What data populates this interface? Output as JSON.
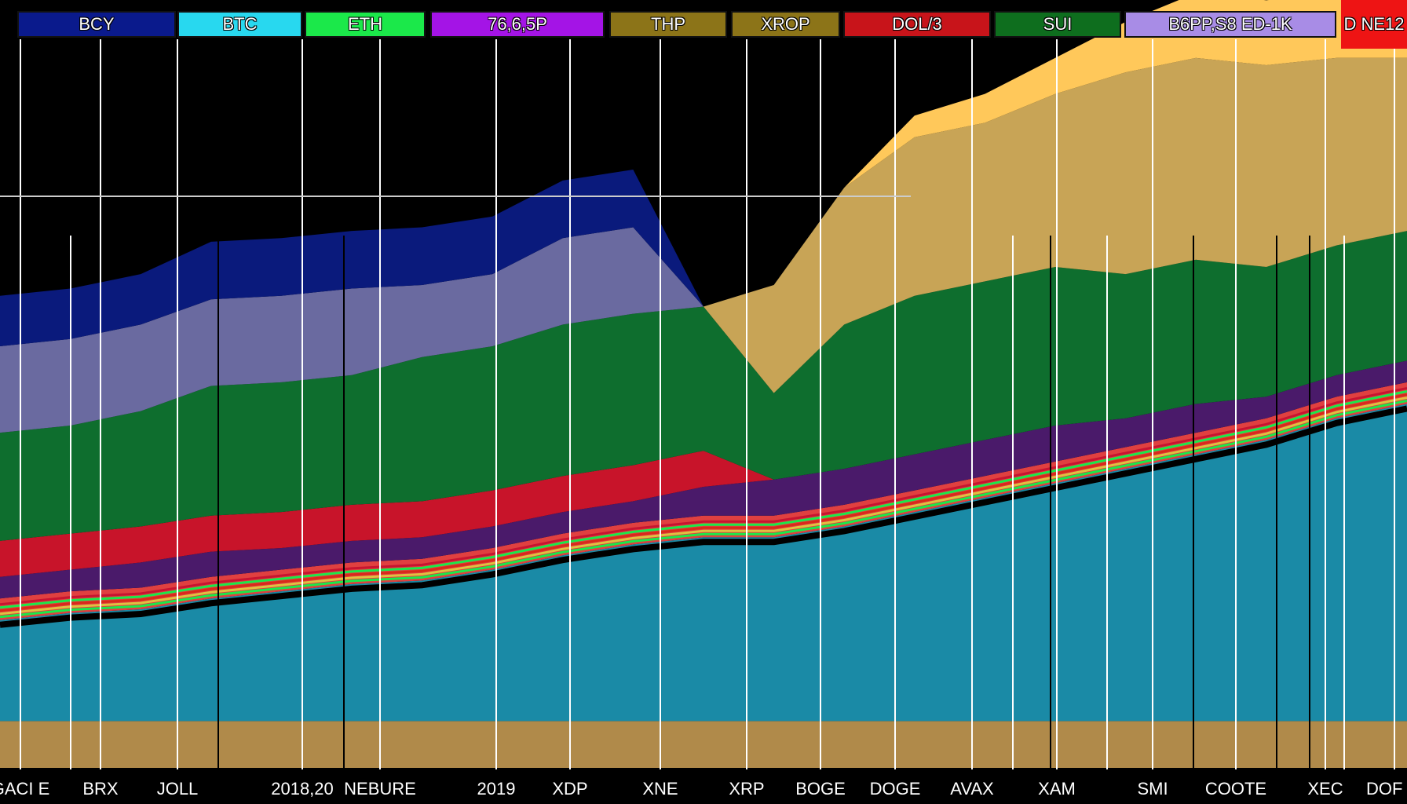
{
  "chart_data": {
    "type": "area",
    "title": "",
    "xlabel": "",
    "ylabel": "",
    "legend": {
      "placement": "top",
      "entries": [
        {
          "label": "BCY",
          "color": "#0a1a8c"
        },
        {
          "label": "BTC",
          "color": "#28d8ef"
        },
        {
          "label": "ETH",
          "color": "#1be84a"
        },
        {
          "label": "76,6,5P",
          "color": "#a414e6"
        },
        {
          "label": "THP",
          "color": "#8c7418"
        },
        {
          "label": "XROP",
          "color": "#8c7418"
        },
        {
          "label": "DOL/3",
          "color": "#c8141a"
        },
        {
          "label": "SUI",
          "color": "#0e6e1e"
        },
        {
          "label": "B6PP,S8 ED-1K",
          "color": "#a88ce6"
        },
        {
          "label": "D NE12",
          "color": "#ee1414"
        }
      ]
    },
    "x_tick_labels": [
      "GACI E",
      "BRX",
      "JOLL",
      "2018,20",
      "NEBURE",
      "2019",
      "XDP",
      "XNE",
      "XRP",
      "BOGE",
      "DOGE",
      "AVAX",
      "XAM",
      "SMI",
      "COOTE",
      "XEC",
      "DOF"
    ],
    "grid": true,
    "ylim": [
      0,
      100
    ],
    "x": [
      0,
      1,
      2,
      3,
      4,
      5,
      6,
      7,
      8,
      9,
      10,
      11,
      12,
      13,
      14,
      15,
      16,
      17,
      18,
      19,
      20
    ],
    "series": [
      {
        "color": "#b08a4a",
        "values": [
          6.5,
          6.5,
          6.5,
          6.5,
          6.5,
          6.5,
          6.5,
          6.5,
          6.5,
          6.5,
          6.5,
          6.5,
          6.5,
          6.5,
          6.5,
          6.5,
          6.5,
          6.5,
          6.5,
          6.5,
          6.5
        ]
      },
      {
        "color": "#1a8aa6",
        "values": [
          14,
          15,
          15.5,
          17,
          18,
          19,
          19.5,
          21,
          23,
          24.5,
          25.5,
          25.5,
          27,
          29,
          31,
          33,
          35,
          37,
          39,
          42,
          44
        ]
      },
      {
        "color": "#e04040",
        "values": [
          3,
          3,
          3,
          3,
          3,
          3,
          3,
          3,
          3,
          3,
          3,
          3,
          3,
          3,
          3,
          3,
          3,
          3,
          3,
          3,
          3
        ]
      },
      {
        "color": "#4a1a6a",
        "values": [
          3,
          3,
          3.5,
          3.5,
          3,
          3,
          3,
          3,
          3,
          3,
          4,
          5,
          5,
          5,
          5,
          5,
          4,
          4,
          3,
          3,
          3
        ]
      },
      {
        "color": "#c8142a",
        "values": [
          5,
          5,
          5,
          5,
          5,
          5,
          5,
          5,
          5,
          5,
          5,
          0,
          0,
          0,
          0,
          0,
          0,
          0,
          0,
          0,
          0
        ]
      },
      {
        "color": "#0e6e2e",
        "values": [
          15,
          15,
          16,
          18,
          18,
          18,
          20,
          20,
          21,
          21,
          20,
          12,
          20,
          22,
          22,
          22,
          20,
          20,
          18,
          18,
          18
        ]
      },
      {
        "color": "#6a6aa0",
        "values": [
          12,
          12,
          12,
          12,
          12,
          12,
          10,
          10,
          12,
          12,
          0,
          0,
          0,
          0,
          0,
          0,
          0,
          0,
          0,
          0,
          0
        ]
      },
      {
        "color": "#0a1a7c",
        "values": [
          7,
          7,
          7,
          8,
          8,
          8,
          8,
          8,
          8,
          8,
          0,
          0,
          0,
          0,
          0,
          0,
          0,
          0,
          0,
          0,
          0
        ]
      },
      {
        "color": "#c8a456",
        "values": [
          0,
          0,
          0,
          0,
          0,
          0,
          0,
          0,
          0,
          0,
          0,
          15,
          19,
          22,
          22,
          24,
          28,
          28,
          28,
          26,
          24
        ]
      },
      {
        "color": "#ffc85a",
        "values": [
          0,
          0,
          0,
          0,
          0,
          0,
          0,
          0,
          0,
          0,
          0,
          0,
          0,
          3,
          4,
          5,
          7,
          9,
          9,
          9,
          9
        ]
      }
    ]
  }
}
